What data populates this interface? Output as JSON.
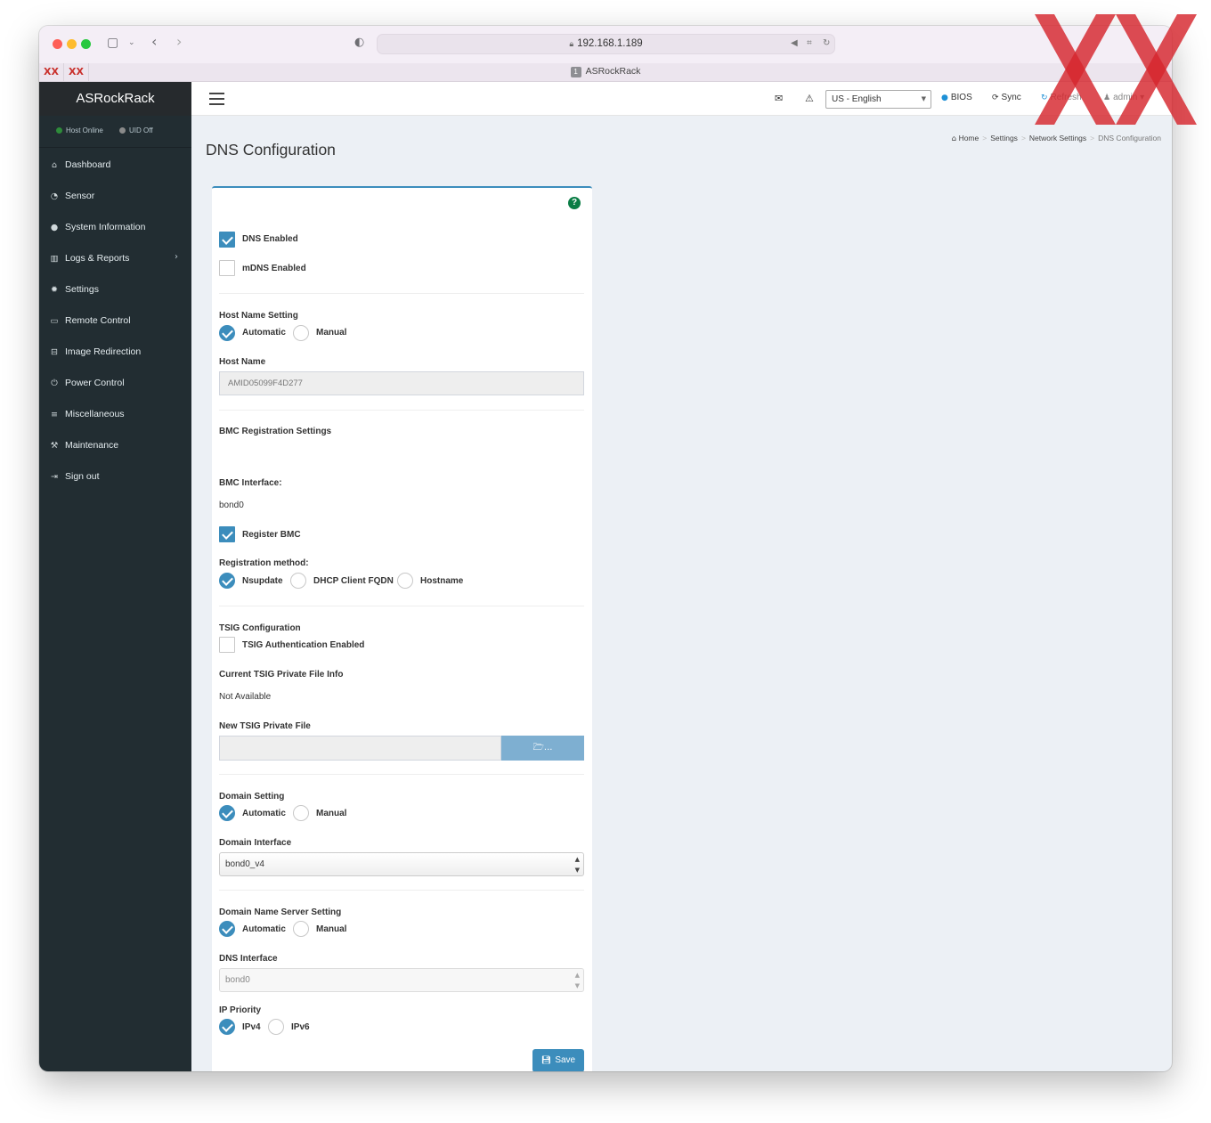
{
  "browser": {
    "url": "192.168.1.189",
    "tab_title": "ASRockRack",
    "tab_number": "1",
    "pinned_tabs": [
      "XX",
      "XX"
    ]
  },
  "sidebar": {
    "brand": "ASRockRack",
    "status": [
      {
        "label": "Host Online",
        "color": "#2e8b3a"
      },
      {
        "label": "UID Off",
        "color": "#8a8a8a"
      }
    ],
    "items": [
      {
        "label": "Dashboard",
        "icon": "home-icon"
      },
      {
        "label": "Sensor",
        "icon": "dashboard-gauge-icon"
      },
      {
        "label": "System Information",
        "icon": "info-circle-icon"
      },
      {
        "label": "Logs & Reports",
        "icon": "bar-chart-icon"
      },
      {
        "label": "Settings",
        "icon": "gear-icon"
      },
      {
        "label": "Remote Control",
        "icon": "monitor-icon"
      },
      {
        "label": "Image Redirection",
        "icon": "hdd-icon"
      },
      {
        "label": "Power Control",
        "icon": "power-icon"
      },
      {
        "label": "Miscellaneous",
        "icon": "list-icon"
      },
      {
        "label": "Maintenance",
        "icon": "wrench-icon"
      },
      {
        "label": "Sign out",
        "icon": "sign-out-icon"
      }
    ]
  },
  "header": {
    "language": "US - English",
    "bios": "BIOS",
    "sync": "Sync",
    "refresh": "Refresh",
    "user": "admin"
  },
  "page": {
    "title": "DNS Configuration",
    "breadcrumb": [
      "Home",
      "Settings",
      "Network Settings",
      "DNS Configuration"
    ]
  },
  "form": {
    "dns_enabled": {
      "label": "DNS Enabled",
      "checked": true
    },
    "mdns_enabled": {
      "label": "mDNS Enabled",
      "checked": false
    },
    "host_name_setting": {
      "label": "Host Name Setting",
      "options": [
        "Automatic",
        "Manual"
      ],
      "selected": "Automatic"
    },
    "host_name": {
      "label": "Host Name",
      "value": "AMID05099F4D277"
    },
    "bmc_registration_title": "BMC Registration Settings",
    "bmc_interface": {
      "label": "BMC Interface:",
      "value": "bond0"
    },
    "register_bmc": {
      "label": "Register BMC",
      "checked": true
    },
    "registration_method": {
      "label": "Registration method:",
      "options": [
        "Nsupdate",
        "DHCP Client FQDN",
        "Hostname"
      ],
      "selected": "Nsupdate"
    },
    "tsig_title": "TSIG Configuration",
    "tsig_auth": {
      "label": "TSIG Authentication Enabled",
      "checked": false
    },
    "current_tsig": {
      "label": "Current TSIG Private File Info",
      "value": "Not Available"
    },
    "new_tsig": {
      "label": "New TSIG Private File",
      "button": "..."
    },
    "domain_setting": {
      "label": "Domain Setting",
      "options": [
        "Automatic",
        "Manual"
      ],
      "selected": "Automatic"
    },
    "domain_interface": {
      "label": "Domain Interface",
      "value": "bond0_v4"
    },
    "dns_server_setting": {
      "label": "Domain Name Server Setting",
      "options": [
        "Automatic",
        "Manual"
      ],
      "selected": "Automatic"
    },
    "dns_interface": {
      "label": "DNS Interface",
      "value": "bond0"
    },
    "ip_priority": {
      "label": "IP Priority",
      "options": [
        "IPv4",
        "IPv6"
      ],
      "selected": "IPv4"
    },
    "save": "Save"
  },
  "colors": {
    "accent": "#3c8dbc",
    "sidebar": "#222d32",
    "help": "#0a7d45",
    "watermark": "#d6262d"
  }
}
